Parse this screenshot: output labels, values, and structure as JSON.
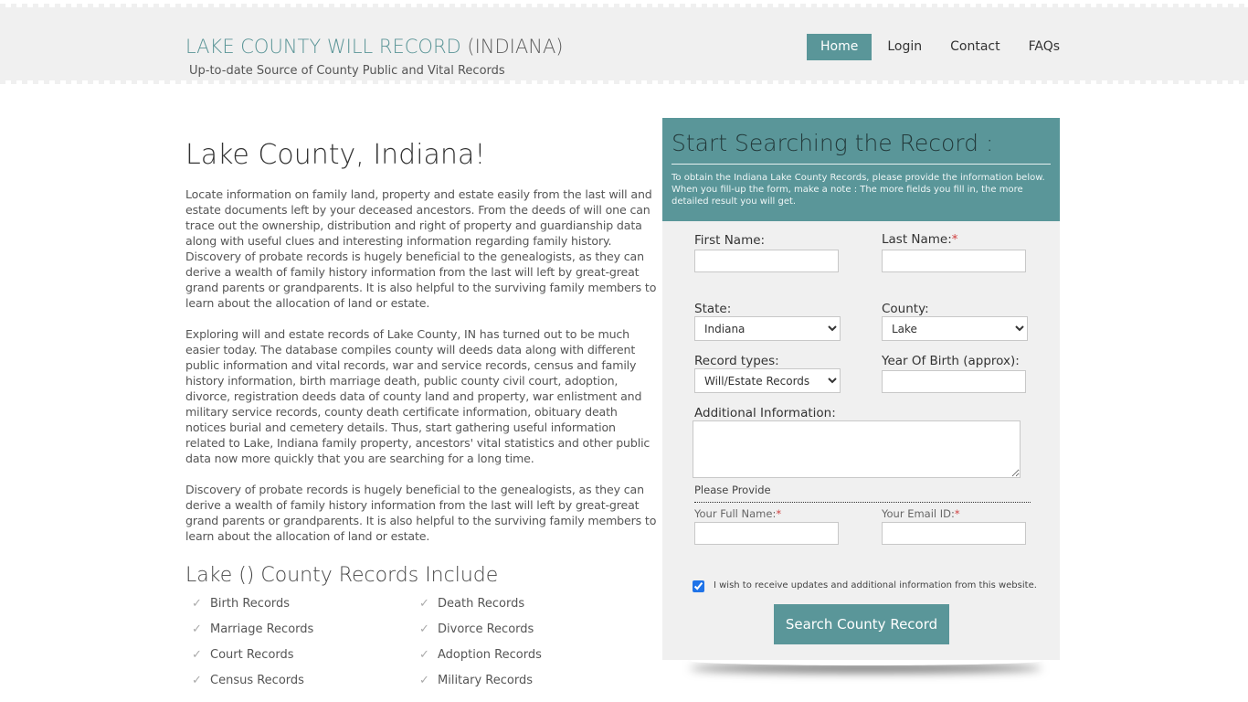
{
  "header": {
    "title_main": "LAKE COUNTY WILL RECORD",
    "title_state": "(INDIANA)",
    "tagline": "Up-to-date Source of  County Public and Vital Records",
    "nav": [
      {
        "label": "Home",
        "active": true
      },
      {
        "label": "Login"
      },
      {
        "label": "Contact"
      },
      {
        "label": "FAQs"
      }
    ]
  },
  "main": {
    "title": "Lake County, Indiana!",
    "paragraphs": [
      "Locate information on family land, property and estate easily from the last will and estate documents left by your deceased ancestors. From the deeds of will one can trace out the ownership, distribution and right of property and guardianship data along with useful clues and interesting information regarding family history. Discovery of probate records is hugely beneficial to the genealogists, as they can derive a wealth of family history information from the last will left by great-great grand parents or grandparents. It is also helpful to the surviving family members to learn about the allocation of land or estate.",
      "Exploring will and estate records of Lake County, IN has turned out to be much easier today. The database compiles county will deeds data along with different public information and vital records, war and service records, census and family history information, birth marriage death, public county civil court, adoption, divorce, registration deeds data of county land and property, war enlistment and military service records, county death certificate information, obituary death notices burial and cemetery details. Thus, start gathering useful information related to Lake, Indiana family property, ancestors' vital statistics and other public data now more quickly that you are searching for a long time.",
      "Discovery of probate records is hugely beneficial to the genealogists, as they can derive a wealth of family history information from the last will left by great-great grand parents or grandparents. It is also helpful to the surviving family members to learn about the allocation of land or estate."
    ],
    "records_title": "Lake () County Records Include",
    "records": [
      "Birth Records",
      "Death Records",
      "Marriage Records",
      "Divorce Records",
      "Court Records",
      "Adoption Records",
      "Census Records",
      "Military Records"
    ],
    "check_icon": "✓"
  },
  "form": {
    "title": "Start Searching the Record :",
    "intro": "To obtain the Indiana Lake County Records, please provide the information below. When you fill-up the form, make a note : The more fields you fill in, the more detailed result you will get.",
    "first_name_label": "First Name:",
    "first_name_value": "",
    "last_name_label": "Last Name:",
    "last_name_value": "",
    "required_mark": "*",
    "state_label": "State:",
    "state_value": "Indiana",
    "county_label": "County:",
    "county_value": "Lake",
    "record_types_label": "Record types:",
    "record_types_value": "Will/Estate Records",
    "yob_label": "Year Of Birth (approx):",
    "yob_value": "",
    "additional_label": "Additional Information:",
    "additional_value": "",
    "please_provide": "Please Provide",
    "full_name_label": "Your Full Name:",
    "email_label": "Your Email ID:",
    "updates_checked": true,
    "updates_label": "I wish to receive updates and additional information from this website.",
    "submit_label": "Search County Record"
  },
  "colors": {
    "accent": "#5a9699",
    "header_bg": "#f0f0f0",
    "required": "#d04040"
  }
}
